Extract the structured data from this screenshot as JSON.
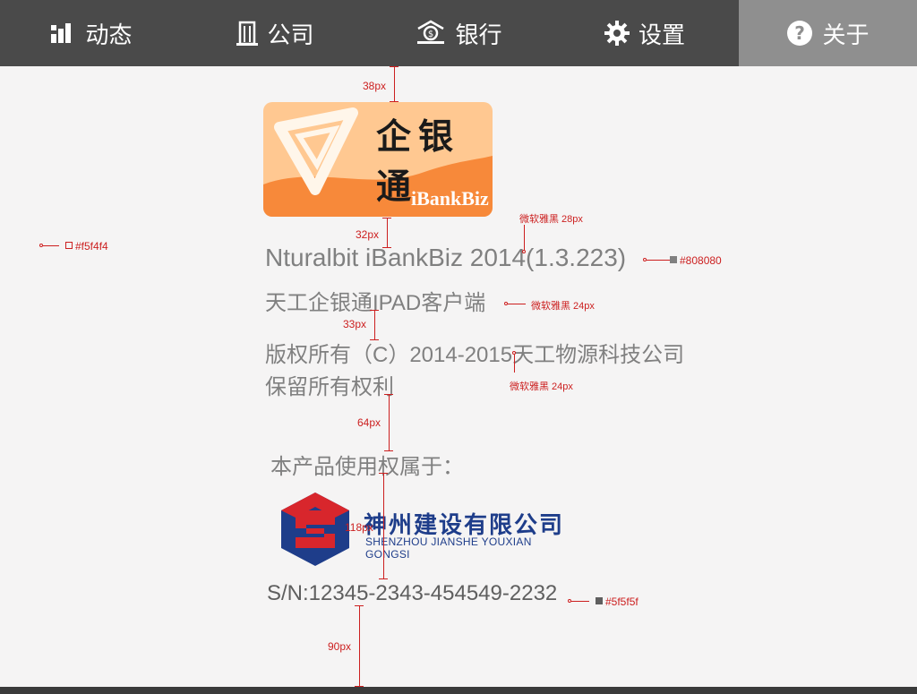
{
  "nav": {
    "tabs": [
      {
        "label": "动态",
        "icon": "bar-chart-icon"
      },
      {
        "label": "公司",
        "icon": "building-icon"
      },
      {
        "label": "银行",
        "icon": "bank-icon"
      },
      {
        "label": "设置",
        "icon": "gear-icon"
      },
      {
        "label": "关于",
        "icon": "help-icon",
        "active": true
      }
    ]
  },
  "logo": {
    "title": "企银通",
    "brand": "iBankBiz"
  },
  "about": {
    "version": "Nturalbit iBankBiz 2014(1.3.223)",
    "app_name": "天工企银通IPAD客户端",
    "copyright_line1": "版权所有（C）2014-2015天工物源科技公司",
    "copyright_line2": "保留所有权利",
    "owner_label": "本产品使用权属于：",
    "company_name": "神州建设有限公司",
    "company_pinyin": "SHENZHOU JIANSHE YOUXIAN GONGSI",
    "serial": "S/N:12345-2343-454549-2232"
  },
  "annotations": {
    "gap_38": "38px",
    "gap_32": "32px",
    "gap_33": "33px",
    "gap_64": "64px",
    "gap_118": "118px",
    "gap_90": "90px",
    "font_28": "微软雅黑  28px",
    "font_24a": "微软雅黑 24px",
    "font_24b": "微软雅黑 24px",
    "color_bg": "#f5f4f4",
    "color_text": "#808080",
    "color_sn": "#5f5f5f"
  },
  "colors": {
    "nav_bg": "#4a4a4a",
    "nav_active": "#8f8f8f",
    "page_bg": "#f5f4f4",
    "text_gray": "#808080",
    "sn_gray": "#5f5f5f",
    "logo_orange": "#f7893a",
    "annotation_red": "#cc1f1f"
  }
}
